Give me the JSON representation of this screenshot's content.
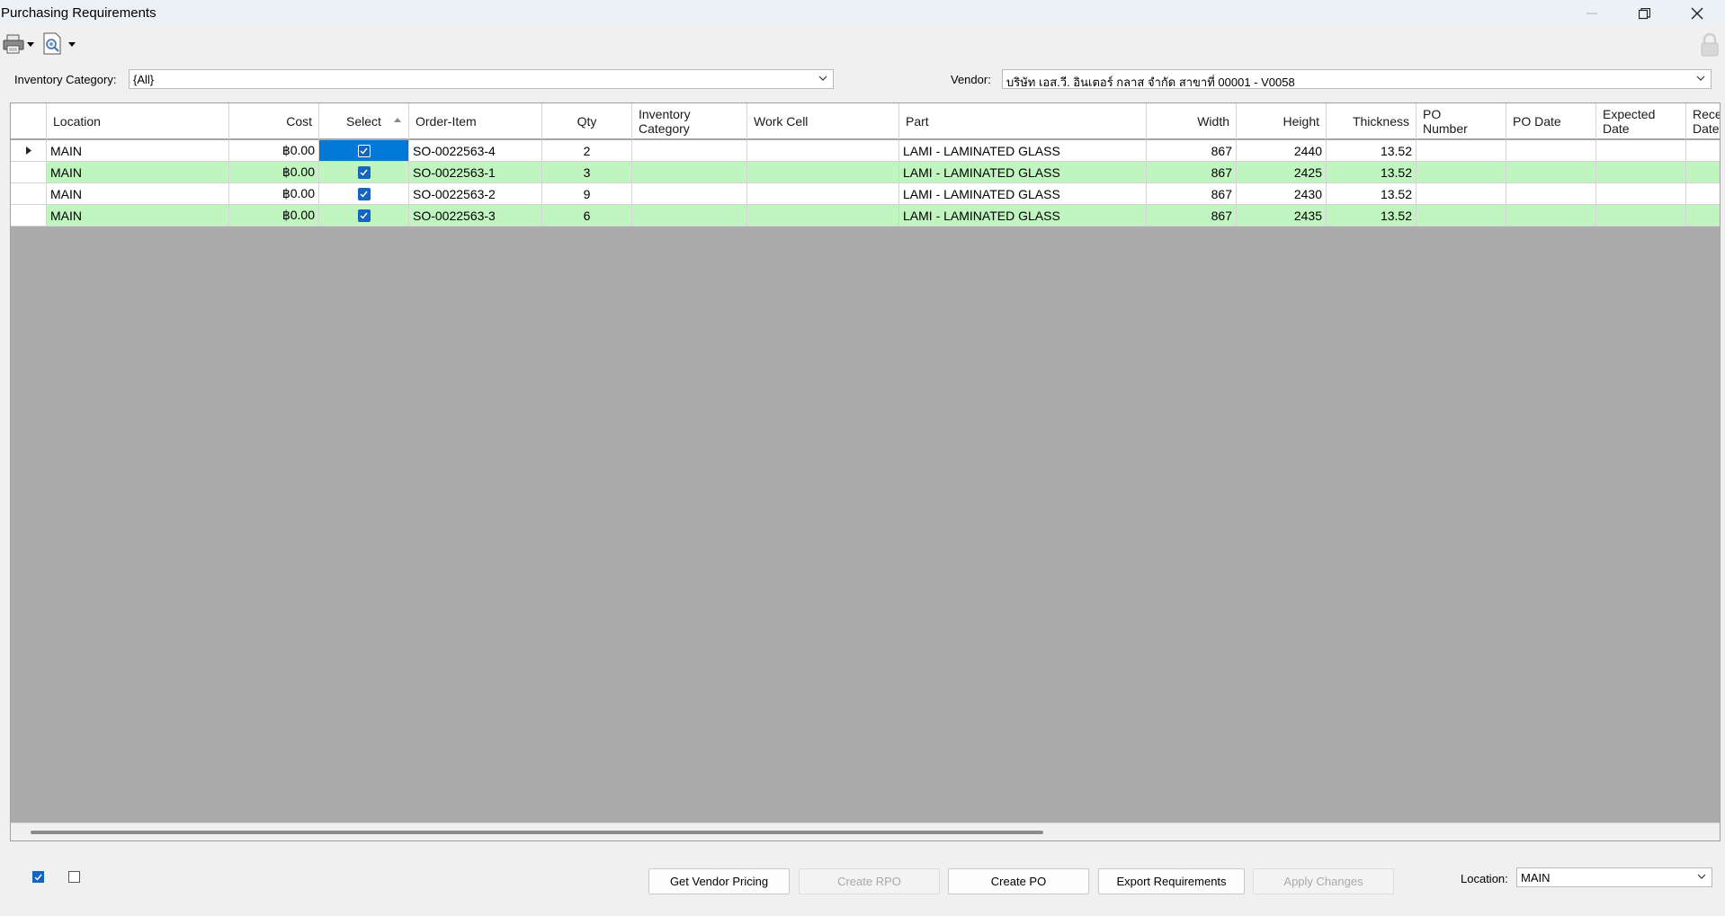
{
  "window": {
    "title": "Purchasing Requirements"
  },
  "toolbar": {
    "print_icon": "printer-icon",
    "preview_icon": "print-preview-icon",
    "lock_icon": "lock-icon"
  },
  "filters": {
    "inventory_category_label": "Inventory Category:",
    "inventory_category_value": "{All}",
    "vendor_label": "Vendor:",
    "vendor_value": "บริษัท เอส.วี. อินเตอร์ กลาส  จำกัด สาขาที่ 00001 - V0058"
  },
  "grid": {
    "columns": [
      "Location",
      "Cost",
      "Select",
      "Order-Item",
      "Qty",
      "Inventory\nCategory",
      "Work Cell",
      "Part",
      "Width",
      "Height",
      "Thickness",
      "PO\nNumber",
      "PO Date",
      "Expected\nDate",
      "Rece\nDate"
    ],
    "sorted_column": "Select",
    "rows": [
      {
        "location": "MAIN",
        "cost": "฿0.00",
        "selected": true,
        "order_item": "SO-0022563-4",
        "qty": "2",
        "inventory_category": "",
        "work_cell": "",
        "part": "LAMI - LAMINATED GLASS",
        "width": "867",
        "height": "2440",
        "thickness": "13.52",
        "po_number": "",
        "po_date": "",
        "expected_date": "",
        "received_date": ""
      },
      {
        "location": "MAIN",
        "cost": "฿0.00",
        "selected": true,
        "order_item": "SO-0022563-1",
        "qty": "3",
        "inventory_category": "",
        "work_cell": "",
        "part": "LAMI - LAMINATED GLASS",
        "width": "867",
        "height": "2425",
        "thickness": "13.52",
        "po_number": "",
        "po_date": "",
        "expected_date": "",
        "received_date": ""
      },
      {
        "location": "MAIN",
        "cost": "฿0.00",
        "selected": true,
        "order_item": "SO-0022563-2",
        "qty": "9",
        "inventory_category": "",
        "work_cell": "",
        "part": "LAMI - LAMINATED GLASS",
        "width": "867",
        "height": "2430",
        "thickness": "13.52",
        "po_number": "",
        "po_date": "",
        "expected_date": "",
        "received_date": ""
      },
      {
        "location": "MAIN",
        "cost": "฿0.00",
        "selected": true,
        "order_item": "SO-0022563-3",
        "qty": "6",
        "inventory_category": "",
        "work_cell": "",
        "part": "LAMI - LAMINATED GLASS",
        "width": "867",
        "height": "2435",
        "thickness": "13.52",
        "po_number": "",
        "po_date": "",
        "expected_date": "",
        "received_date": ""
      }
    ]
  },
  "bottom": {
    "buttons": {
      "get_vendor_pricing": "Get Vendor Pricing",
      "create_rpo": "Create RPO",
      "create_po": "Create PO",
      "export_requirements": "Export Requirements",
      "apply_changes": "Apply Changes"
    },
    "location_label": "Location:",
    "location_value": "MAIN"
  },
  "colors": {
    "accent": "#1565c0",
    "row_alt": "#c0f5c0",
    "grid_background": "#ababab",
    "selected_cell": "#0078d7"
  }
}
